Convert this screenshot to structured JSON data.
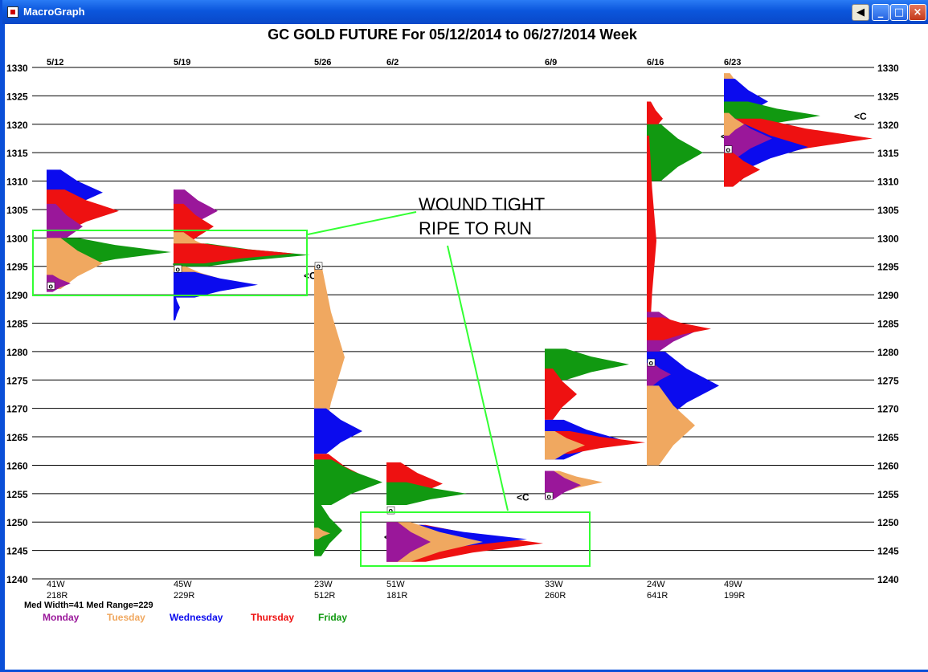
{
  "window": {
    "title": "MacroGraph",
    "buttons": {
      "back": "◀",
      "minimize": "_",
      "maximize": "□",
      "close": "×"
    }
  },
  "chart_data": {
    "type": "bar",
    "subtype": "market-profile",
    "title": "GC   GOLD FUTURE  For 05/12/2014 to 06/27/2014 Week",
    "y_ticks": [
      1330,
      1325,
      1320,
      1315,
      1310,
      1305,
      1300,
      1295,
      1290,
      1285,
      1280,
      1275,
      1270,
      1265,
      1260,
      1255,
      1250,
      1245,
      1240
    ],
    "ylim": [
      1240,
      1330
    ],
    "grid": true,
    "grid_axis": "y",
    "legend": [
      {
        "name": "Monday",
        "color": "#9A179A"
      },
      {
        "name": "Tuesday",
        "color": "#F0A860"
      },
      {
        "name": "Wednesday",
        "color": "#0B0BEE"
      },
      {
        "name": "Thursday",
        "color": "#EE1111"
      },
      {
        "name": "Friday",
        "color": "#119911"
      }
    ],
    "legend_position": "bottom-left",
    "stats_line": "Med Width=41  Med Range=229",
    "weeks": [
      {
        "label": "5/12",
        "width_label": "41W",
        "range_label": "218R",
        "low": 1290.5,
        "high": 1312,
        "open": 1291.5,
        "close": 1295.5,
        "close_label": "<C",
        "open_label": "o",
        "segments": [
          {
            "day": "Wednesday",
            "lo": 1304,
            "hi": 1312,
            "w": 70
          },
          {
            "day": "Thursday",
            "lo": 1301,
            "hi": 1308.5,
            "w": 90
          },
          {
            "day": "Monday",
            "lo": 1298,
            "hi": 1306,
            "w": 45
          },
          {
            "day": "Friday",
            "lo": 1295,
            "hi": 1300,
            "w": 155
          },
          {
            "day": "Tuesday",
            "lo": 1291,
            "hi": 1300,
            "w": 70
          },
          {
            "day": "Monday",
            "lo": 1290.5,
            "hi": 1293.5,
            "w": 30
          }
        ]
      },
      {
        "label": "5/19",
        "width_label": "45W",
        "range_label": "229R",
        "low": 1285.5,
        "high": 1308.5,
        "open": 1294.5,
        "close": 1293.5,
        "close_label": "<C",
        "open_label": "o",
        "segments": [
          {
            "day": "Monday",
            "lo": 1301,
            "hi": 1308.5,
            "w": 55
          },
          {
            "day": "Thursday",
            "lo": 1298,
            "hi": 1306,
            "w": 50
          },
          {
            "day": "Tuesday",
            "lo": 1295,
            "hi": 1301,
            "w": 50
          },
          {
            "day": "Friday",
            "lo": 1295,
            "hi": 1299,
            "w": 170
          },
          {
            "day": "Thursday",
            "lo": 1295.5,
            "hi": 1299,
            "w": 150
          },
          {
            "day": "Tuesday",
            "lo": 1290.5,
            "hi": 1295,
            "w": 60
          },
          {
            "day": "Wednesday",
            "lo": 1289.5,
            "hi": 1294,
            "w": 105
          },
          {
            "day": "Wednesday",
            "lo": 1285.5,
            "hi": 1290,
            "w": 8
          }
        ]
      },
      {
        "label": "5/26",
        "width_label": "23W",
        "range_label": "512R",
        "low": 1244,
        "high": 1295,
        "open": 1295,
        "close": 1247.5,
        "close_label": "<C",
        "open_label": "o",
        "segments": [
          {
            "day": "Tuesday",
            "lo": 1263,
            "hi": 1295,
            "w": 38
          },
          {
            "day": "Wednesday",
            "lo": 1262,
            "hi": 1270,
            "w": 60
          },
          {
            "day": "Thursday",
            "lo": 1253,
            "hi": 1262,
            "w": 70
          },
          {
            "day": "Friday",
            "lo": 1253,
            "hi": 1261,
            "w": 85
          },
          {
            "day": "Friday",
            "lo": 1244,
            "hi": 1253,
            "w": 35
          },
          {
            "day": "Tuesday",
            "lo": 1247,
            "hi": 1249,
            "w": 20
          }
        ]
      },
      {
        "label": "6/2",
        "width_label": "51W",
        "range_label": "181R",
        "low": 1243,
        "high": 1260.5,
        "open": 1252,
        "close": 1254.5,
        "close_label": "<C",
        "open_label": "o",
        "segments": [
          {
            "day": "Thursday",
            "lo": 1253,
            "hi": 1260.5,
            "w": 70
          },
          {
            "day": "Friday",
            "lo": 1253,
            "hi": 1257,
            "w": 100
          },
          {
            "day": "Thursday",
            "lo": 1243,
            "hi": 1249.5,
            "w": 195
          },
          {
            "day": "Wednesday",
            "lo": 1244.5,
            "hi": 1249.5,
            "w": 175
          },
          {
            "day": "Tuesday",
            "lo": 1243,
            "hi": 1250,
            "w": 120
          },
          {
            "day": "Monday",
            "lo": 1243,
            "hi": 1250,
            "w": 55
          }
        ]
      },
      {
        "label": "6/9",
        "width_label": "33W",
        "range_label": "260R",
        "low": 1254,
        "high": 1280.5,
        "open": 1254.5,
        "close": 1275.5,
        "close_label": "<C",
        "open_label": "o",
        "segments": [
          {
            "day": "Friday",
            "lo": 1275,
            "hi": 1280.5,
            "w": 105
          },
          {
            "day": "Thursday",
            "lo": 1268,
            "hi": 1277,
            "w": 40
          },
          {
            "day": "Wednesday",
            "lo": 1261,
            "hi": 1268,
            "w": 95
          },
          {
            "day": "Thursday",
            "lo": 1262,
            "hi": 1266,
            "w": 125
          },
          {
            "day": "Tuesday",
            "lo": 1261,
            "hi": 1266,
            "w": 50
          },
          {
            "day": "Tuesday",
            "lo": 1255,
            "hi": 1259,
            "w": 72
          },
          {
            "day": "Monday",
            "lo": 1254,
            "hi": 1259,
            "w": 45
          }
        ]
      },
      {
        "label": "6/16",
        "width_label": "24W",
        "range_label": "641R",
        "low": 1260,
        "high": 1324,
        "open": 1278,
        "close": 1318,
        "close_label": "<C",
        "open_label": "o",
        "segments": [
          {
            "day": "Thursday",
            "lo": 1318,
            "hi": 1324,
            "w": 20
          },
          {
            "day": "Friday",
            "lo": 1310,
            "hi": 1320,
            "w": 70
          },
          {
            "day": "Thursday",
            "lo": 1281,
            "hi": 1318,
            "w": 12
          },
          {
            "day": "Monday",
            "lo": 1280,
            "hi": 1287,
            "w": 60
          },
          {
            "day": "Thursday",
            "lo": 1282,
            "hi": 1286,
            "w": 80
          },
          {
            "day": "Wednesday",
            "lo": 1268,
            "hi": 1280,
            "w": 90
          },
          {
            "day": "Monday",
            "lo": 1274,
            "hi": 1278,
            "w": 30
          },
          {
            "day": "Tuesday",
            "lo": 1260,
            "hi": 1274,
            "w": 60
          }
        ]
      },
      {
        "label": "6/23",
        "width_label": "49W",
        "range_label": "199R",
        "low": 1309,
        "high": 1329,
        "open": 1315.5,
        "close": 1321.5,
        "close_label": "<C",
        "open_label": "o",
        "segments": [
          {
            "day": "Tuesday",
            "lo": 1322,
            "hi": 1329,
            "w": 30
          },
          {
            "day": "Wednesday",
            "lo": 1320,
            "hi": 1328,
            "w": 55
          },
          {
            "day": "Friday",
            "lo": 1319,
            "hi": 1324,
            "w": 120
          },
          {
            "day": "Thursday",
            "lo": 1314,
            "hi": 1321,
            "w": 185
          },
          {
            "day": "Wednesday",
            "lo": 1312,
            "hi": 1320,
            "w": 105
          },
          {
            "day": "Monday",
            "lo": 1314,
            "hi": 1321,
            "w": 60
          },
          {
            "day": "Tuesday",
            "lo": 1318,
            "hi": 1322,
            "w": 25
          },
          {
            "day": "Thursday",
            "lo": 1309,
            "hi": 1315,
            "w": 45
          }
        ]
      }
    ],
    "annotations": [
      {
        "text": "WOUND TIGHT"
      },
      {
        "text": "RIPE TO RUN"
      }
    ]
  }
}
